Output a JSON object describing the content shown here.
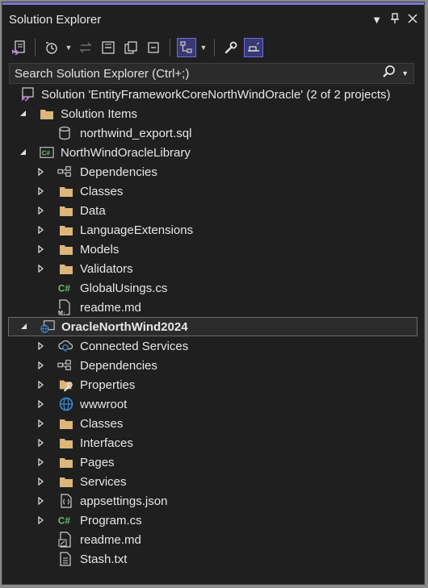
{
  "window": {
    "title": "Solution Explorer"
  },
  "search": {
    "placeholder": "Search Solution Explorer (Ctrl+;)"
  },
  "tree": {
    "solution": "Solution 'EntityFrameworkCoreNorthWindOracle' (2 of 2 projects)",
    "solution_items": "Solution Items",
    "sql_file": "northwind_export.sql",
    "library_project": "NorthWindOracleLibrary",
    "lib_dependencies": "Dependencies",
    "lib_classes": "Classes",
    "lib_data": "Data",
    "lib_language_extensions": "LanguageExtensions",
    "lib_models": "Models",
    "lib_validators": "Validators",
    "lib_global_usings": "GlobalUsings.cs",
    "lib_readme": "readme.md",
    "web_project": "OracleNorthWind2024",
    "web_connected_services": "Connected Services",
    "web_dependencies": "Dependencies",
    "web_properties": "Properties",
    "web_wwwroot": "wwwroot",
    "web_classes": "Classes",
    "web_interfaces": "Interfaces",
    "web_pages": "Pages",
    "web_services": "Services",
    "web_appsettings": "appsettings.json",
    "web_program": "Program.cs",
    "web_readme": "readme.md",
    "web_stash": "Stash.txt"
  },
  "colors": {
    "background": "#1f1f1f",
    "folder": "#dcb67a",
    "csharp": "#68c16f",
    "accent": "#7a7ad6",
    "globe": "#3d8ee0"
  }
}
